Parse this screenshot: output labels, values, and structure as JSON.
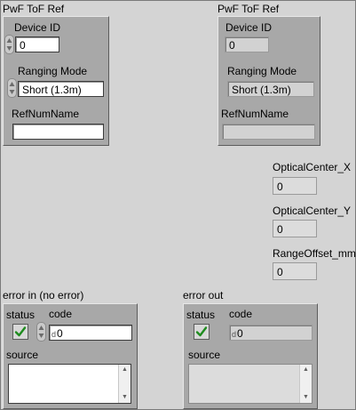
{
  "left_cluster": {
    "title": "PwF ToF Ref",
    "device_id_label": "Device ID",
    "device_id_value": "0",
    "ranging_mode_label": "Ranging Mode",
    "ranging_mode_value": "Short (1.3m)",
    "refnum_label": "RefNumName",
    "refnum_value": ""
  },
  "right_cluster": {
    "title": "PwF ToF Ref",
    "device_id_label": "Device ID",
    "device_id_value": "0",
    "ranging_mode_label": "Ranging Mode",
    "ranging_mode_value": "Short (1.3m)",
    "refnum_label": "RefNumName",
    "refnum_value": ""
  },
  "indicators": {
    "optical_center_x_label": "OpticalCenter_X",
    "optical_center_x_value": "0",
    "optical_center_y_label": "OpticalCenter_Y",
    "optical_center_y_value": "0",
    "range_offset_label": "RangeOffset_mm",
    "range_offset_value": "0"
  },
  "error_in": {
    "title": "error in (no error)",
    "status_label": "status",
    "code_label": "code",
    "radix": "d",
    "code_value": "0",
    "source_label": "source",
    "source_value": ""
  },
  "error_out": {
    "title": "error out",
    "status_label": "status",
    "code_label": "code",
    "radix": "d",
    "code_value": "0",
    "source_label": "source",
    "source_value": ""
  },
  "colors": {
    "background": "#d4d4d4",
    "cluster": "#a8a8a8",
    "check_green": "#1e8c1e"
  },
  "icons": [
    "spinner-arrows-icon",
    "checkmark-icon",
    "scroll-up-icon",
    "scroll-down-icon"
  ]
}
